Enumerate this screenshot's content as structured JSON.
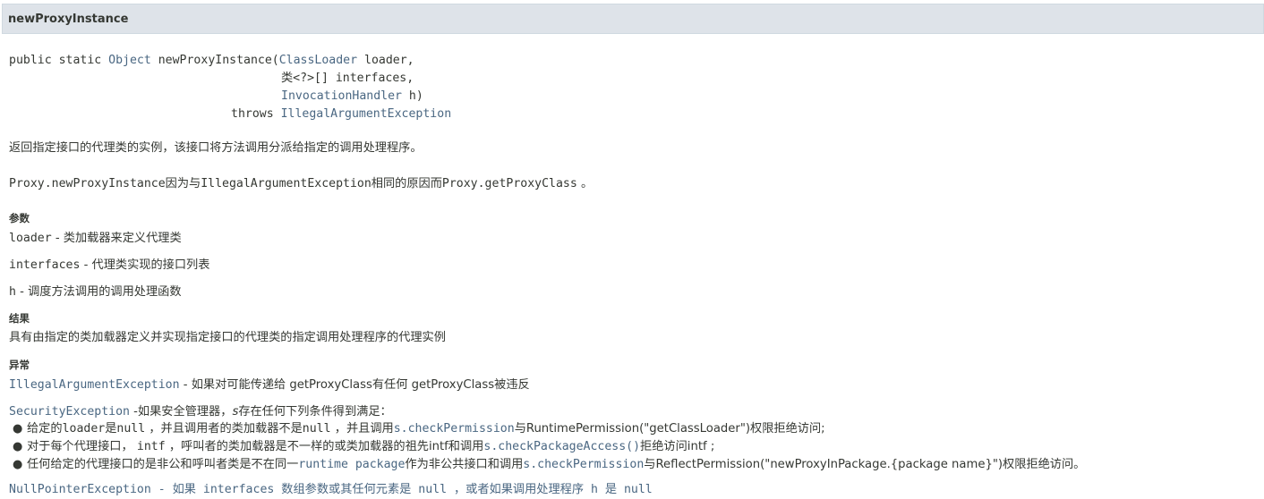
{
  "header": {
    "title": "newProxyInstance"
  },
  "signature": {
    "line1": {
      "pre": "public static ",
      "type": "Object",
      "name": " newProxyInstance(",
      "param_type": "ClassLoader",
      "param": " loader,"
    },
    "line2": {
      "text": "类<?>[] interfaces,"
    },
    "line3": {
      "param_type": "InvocationHandler",
      "param": " h)"
    },
    "line4": {
      "throws": "throws ",
      "exception": "IllegalArgumentException"
    }
  },
  "description": "返回指定接口的代理类的实例，该接口将方法调用分派给指定的调用处理程序。",
  "note": {
    "code1": "Proxy.newProxyInstance",
    "mid1": "因为与",
    "code2": "IllegalArgumentException",
    "mid2": "相同的原因而",
    "code3": "Proxy.getProxyClass",
    "end": " 。"
  },
  "params": {
    "label": "参数",
    "items": [
      {
        "name": "loader",
        "desc": " - 类加载器来定义代理类"
      },
      {
        "name": "interfaces",
        "desc": " - 代理类实现的接口列表"
      },
      {
        "name": "h",
        "desc": " - 调度方法调用的调用处理函数"
      }
    ]
  },
  "result": {
    "label": "结果",
    "text": "具有由指定的类加载器定义并实现指定接口的代理类的指定调用处理程序的代理实例"
  },
  "exceptions": {
    "label": "异常",
    "iae": {
      "name": "IllegalArgumentException",
      "desc": " - 如果对可能传递给 getProxyClass有任何 getProxyClass被违反"
    },
    "se": {
      "name": "SecurityException",
      "desc_pre": " -如果安全管理器，",
      "s": "s",
      "desc_post": "存在任何下列条件得到满足："
    },
    "conditions": [
      {
        "parts": [
          "给定的",
          "loader",
          "是",
          "null",
          " ，并且调用者的类加载器不是",
          "null",
          " ，并且调用",
          "s.checkPermission",
          "与RuntimePermission(\"getClassLoader\")权限拒绝访问;"
        ]
      },
      {
        "parts": [
          "对于每个代理接口， ",
          "intf",
          " ，呼叫者的类加载器是不一样的或类加载器的祖先intf和调用",
          "s.checkPackageAccess()",
          "拒绝访问intf ;"
        ]
      },
      {
        "parts": [
          "任何给定的代理接口的是非公和呼叫者类是不在同一",
          "runtime package",
          "作为非公共接口和调用",
          "s.checkPermission",
          "与ReflectPermission(\"newProxyInPackage.{package name}\")权限拒绝访问。"
        ]
      }
    ],
    "npe_partial": "NullPointerException - 如果 interfaces 数组参数或其任何元素是 null ，或者如果调用处理程序 h 是 null"
  }
}
